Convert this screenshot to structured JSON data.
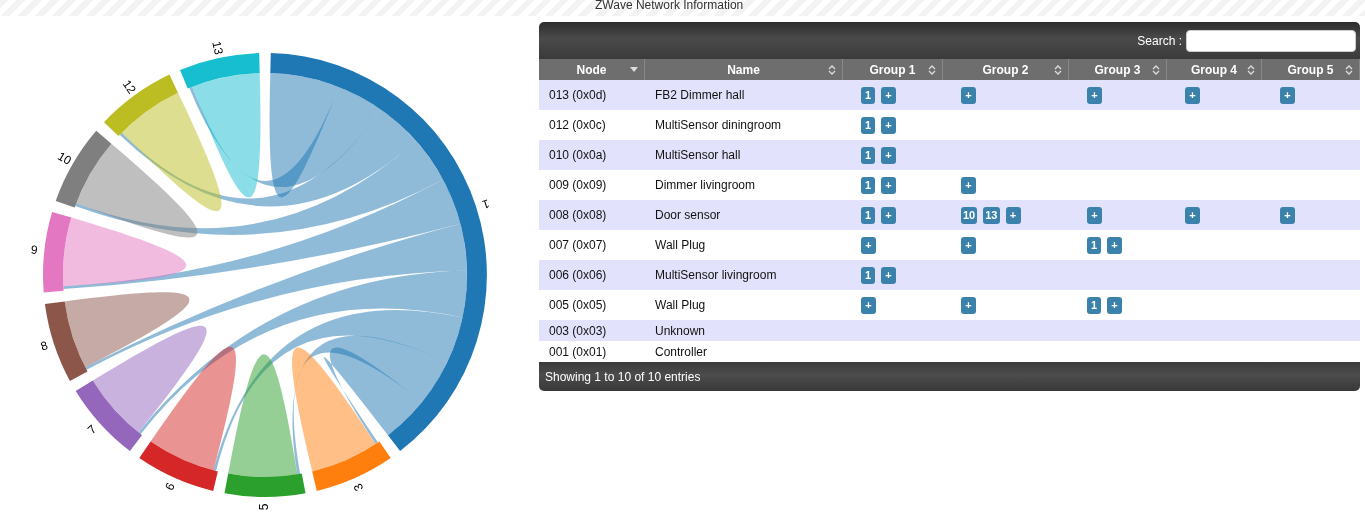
{
  "chord_diagram": {
    "groups": [
      {
        "label": "1",
        "color": "#1f77b4"
      },
      {
        "label": "3",
        "color": "#ff7f0e"
      },
      {
        "label": "5",
        "color": "#2ca02c"
      },
      {
        "label": "6",
        "color": "#d62728"
      },
      {
        "label": "7",
        "color": "#9467bd"
      },
      {
        "label": "8",
        "color": "#8c564b"
      },
      {
        "label": "9",
        "color": "#e377c2"
      },
      {
        "label": "10",
        "color": "#7f7f7f"
      },
      {
        "label": "12",
        "color": "#bcbd22"
      },
      {
        "label": "13",
        "color": "#17becf"
      }
    ]
  },
  "title": "ZWave Network Information",
  "search": {
    "label": "Search :"
  },
  "table": {
    "columns": [
      {
        "label": "Node",
        "sorted": true
      },
      {
        "label": "Name",
        "sorted": false
      },
      {
        "label": "Group 1",
        "sorted": false
      },
      {
        "label": "Group 2",
        "sorted": false
      },
      {
        "label": "Group 3",
        "sorted": false
      },
      {
        "label": "Group 4",
        "sorted": false
      },
      {
        "label": "Group 5",
        "sorted": false
      }
    ],
    "rows": [
      {
        "node": "013 (0x0d)",
        "name": "FB2 Dimmer hall",
        "groups": [
          {
            "members": [
              "1"
            ],
            "add": "+"
          },
          {
            "add": "+"
          },
          {
            "add": "+"
          },
          {
            "add": "+"
          },
          {
            "add": "+"
          }
        ]
      },
      {
        "node": "012 (0x0c)",
        "name": "MultiSensor diningroom",
        "groups": [
          {
            "members": [
              "1"
            ],
            "add": "+"
          }
        ]
      },
      {
        "node": "010 (0x0a)",
        "name": "MultiSensor hall",
        "groups": [
          {
            "members": [
              "1"
            ],
            "add": "+"
          }
        ]
      },
      {
        "node": "009 (0x09)",
        "name": "Dimmer livingroom",
        "groups": [
          {
            "members": [
              "1"
            ],
            "add": "+"
          },
          {
            "add": "+"
          }
        ]
      },
      {
        "node": "008 (0x08)",
        "name": "Door sensor",
        "groups": [
          {
            "members": [
              "1"
            ],
            "add": "+"
          },
          {
            "members": [
              "10",
              "13"
            ],
            "add": "+"
          },
          {
            "add": "+"
          },
          {
            "add": "+"
          },
          {
            "add": "+"
          }
        ]
      },
      {
        "node": "007 (0x07)",
        "name": "Wall Plug",
        "groups": [
          {
            "add": "+"
          },
          {
            "add": "+"
          },
          {
            "members": [
              "1"
            ],
            "add": "+"
          }
        ]
      },
      {
        "node": "006 (0x06)",
        "name": "MultiSensor livingroom",
        "groups": [
          {
            "members": [
              "1"
            ],
            "add": "+"
          }
        ]
      },
      {
        "node": "005 (0x05)",
        "name": "Wall Plug",
        "groups": [
          {
            "add": "+"
          },
          {
            "add": "+"
          },
          {
            "members": [
              "1"
            ],
            "add": "+"
          }
        ]
      },
      {
        "node": "003 (0x03)",
        "name": "Unknown"
      },
      {
        "node": "001 (0x01)",
        "name": "Controller"
      }
    ]
  },
  "footer": "Showing 1 to 10 of 10 entries"
}
